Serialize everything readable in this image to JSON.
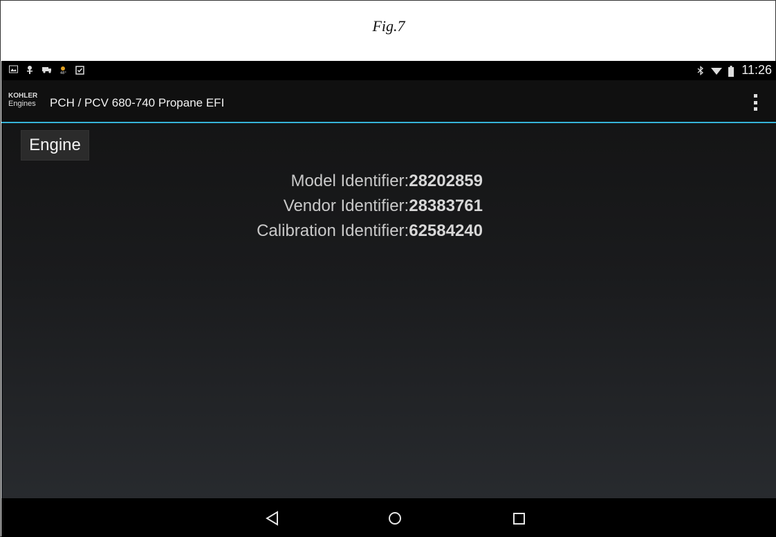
{
  "figure": {
    "caption": "Fig.7"
  },
  "status_bar": {
    "left_icons": [
      "gallery-icon",
      "bug-icon",
      "truck-icon",
      "weather-icon",
      "clipboard-check-icon"
    ],
    "right_icons": [
      "bluetooth-icon",
      "wifi-icon",
      "battery-icon"
    ],
    "time": "11:26"
  },
  "action_bar": {
    "logo_line1": "KOHLER",
    "logo_line2": "Engines",
    "title": "PCH / PCV 680-740 Propane EFI"
  },
  "engine_tab": {
    "label": "Engine"
  },
  "identifiers": [
    {
      "label": "Model Identifier:",
      "value": "28202859"
    },
    {
      "label": "Vendor Identifier:",
      "value": "28383761"
    },
    {
      "label": "Calibration Identifier:",
      "value": "62584240"
    }
  ],
  "nav_bar": {
    "buttons": [
      "back-icon",
      "home-icon",
      "recents-icon"
    ]
  },
  "colors": {
    "accent": "#36b3d8",
    "background": "#121212"
  }
}
